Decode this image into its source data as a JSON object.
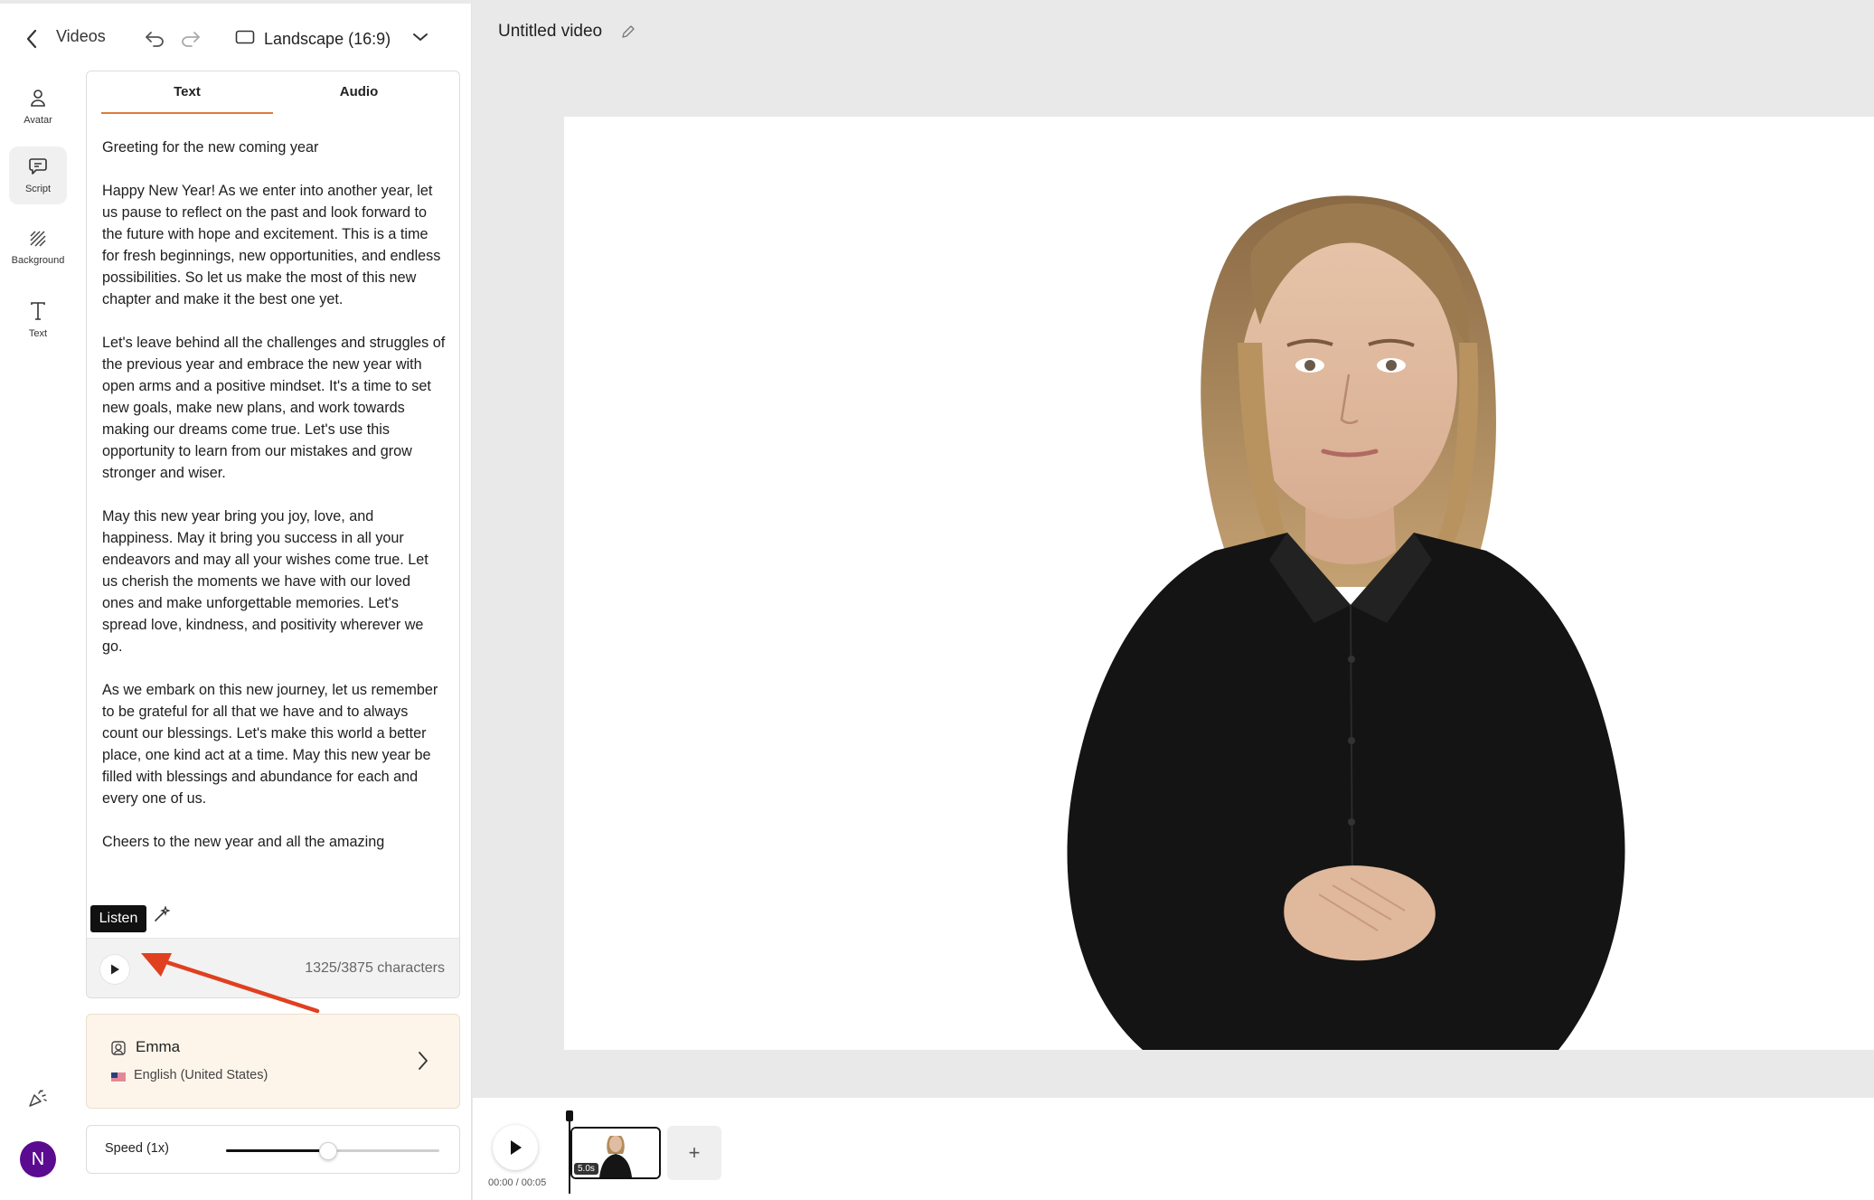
{
  "topbar": {
    "back_label": "Videos",
    "aspect_label": "Landscape (16:9)"
  },
  "rail": {
    "items": [
      {
        "label": "Avatar"
      },
      {
        "label": "Script"
      },
      {
        "label": "Background"
      },
      {
        "label": "Text"
      }
    ],
    "user_initial": "N"
  },
  "script": {
    "tabs": [
      {
        "label": "Text"
      },
      {
        "label": "Audio"
      }
    ],
    "body": "Greeting for the new coming year\n\nHappy New Year! As we enter into another year, let us pause to reflect on the past and look forward to the future with hope and excitement. This is a time for fresh beginnings, new opportunities, and endless possibilities. So let us make the most of this new chapter and make it the best one yet.\n\nLet's leave behind all the challenges and struggles of the previous year and embrace the new year with open arms and a positive mindset. It's a time to set new goals, make new plans, and work towards making our dreams come true. Let's use this opportunity to learn from our mistakes and grow stronger and wiser.\n\nMay this new year bring you joy, love, and happiness. May it bring you success in all your endeavors and may all your wishes come true. Let us cherish the moments we have with our loved ones and make unforgettable memories. Let's spread love, kindness, and positivity wherever we go.\n\nAs we embark on this new journey, let us remember to be grateful for all that we have and to always count our blessings. Let's make this world a better place, one kind act at a time. May this new year be filled with blessings and abundance for each and every one of us.\n\nCheers to the new year and all the amazing",
    "tooltip": "Listen",
    "char_count": "1325/3875 characters"
  },
  "voice": {
    "name": "Emma",
    "language": "English (United States)"
  },
  "speed": {
    "label": "Speed (1x)",
    "value_fraction": 0.48
  },
  "editor": {
    "video_title": "Untitled video",
    "time_readout": "00:00 / 00:05",
    "clip_duration": "5.0s",
    "add_label": "+"
  },
  "colors": {
    "accent_tab": "#e07a3a",
    "user_avatar": "#5b0b8f",
    "voice_card_bg": "#fdf5ea",
    "annotation_arrow": "#e0401f"
  },
  "icons": {
    "back": "chevron-left-icon",
    "undo": "undo-icon",
    "redo": "redo-icon",
    "aspect": "rectangle-icon",
    "dropdown": "chevron-down-icon",
    "avatar": "person-icon",
    "script": "chat-bubble-icon",
    "background": "hatch-pattern-icon",
    "text": "text-t-icon",
    "magic": "magic-wand-icon",
    "play": "play-icon",
    "voice": "voice-avatar-icon",
    "flag": "us-flag-icon",
    "chevron_right": "chevron-right-icon",
    "edit": "pencil-icon",
    "feedback": "party-popper-icon"
  }
}
